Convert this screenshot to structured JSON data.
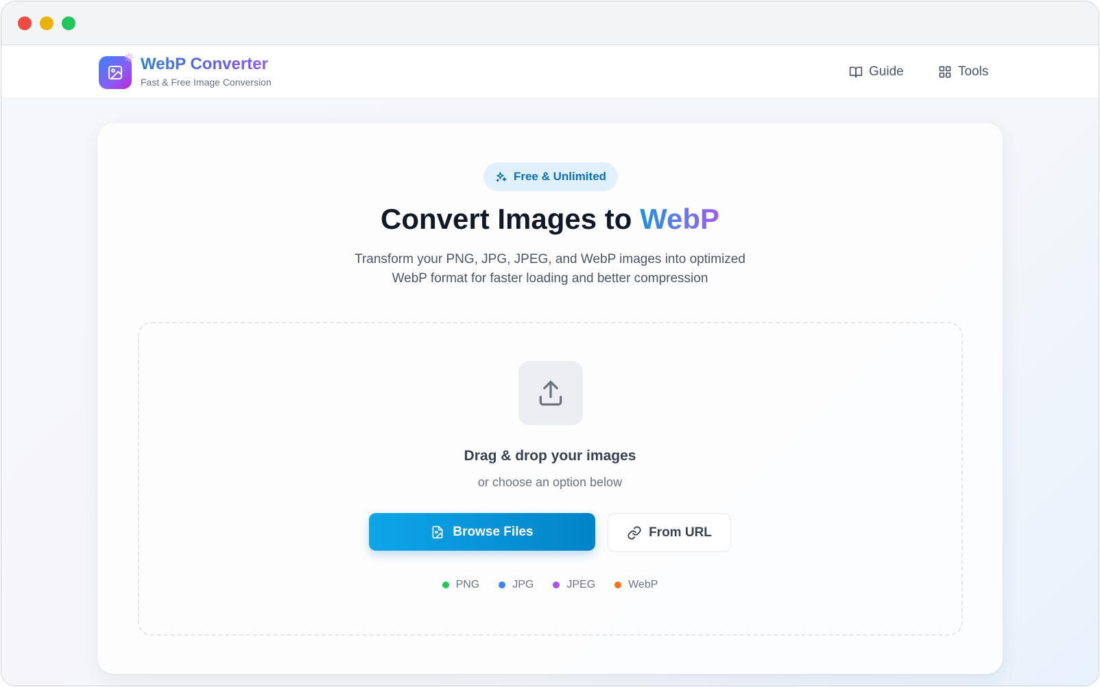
{
  "brand": {
    "title": "WebP Converter",
    "subtitle": "Fast & Free Image Conversion"
  },
  "nav": {
    "guide_label": "Guide",
    "tools_label": "Tools"
  },
  "hero": {
    "badge": "Free & Unlimited",
    "title_prefix": "Convert Images to ",
    "title_accent": "WebP",
    "subtitle_line1": "Transform your PNG, JPG, JPEG, and WebP images into optimized",
    "subtitle_line2": "WebP format for faster loading and better compression"
  },
  "dropzone": {
    "title": "Drag & drop your images",
    "subtitle": "or choose an option below",
    "browse_label": "Browse Files",
    "url_label": "From URL",
    "formats": [
      {
        "label": "PNG",
        "color": "#22c55e"
      },
      {
        "label": "JPG",
        "color": "#3b82f6"
      },
      {
        "label": "JPEG",
        "color": "#a855f7"
      },
      {
        "label": "WebP",
        "color": "#f97316"
      }
    ]
  },
  "icons": {
    "logo": "image-icon",
    "badge": "sparkles-icon",
    "guide": "book-open-icon",
    "tools": "grid-icon",
    "upload": "upload-icon",
    "browse": "file-image-icon",
    "url": "link-icon"
  },
  "colors": {
    "accent": "#0ea5e9",
    "brand_gradient_start": "#3b82f6",
    "brand_gradient_end": "#8b5cf6"
  }
}
